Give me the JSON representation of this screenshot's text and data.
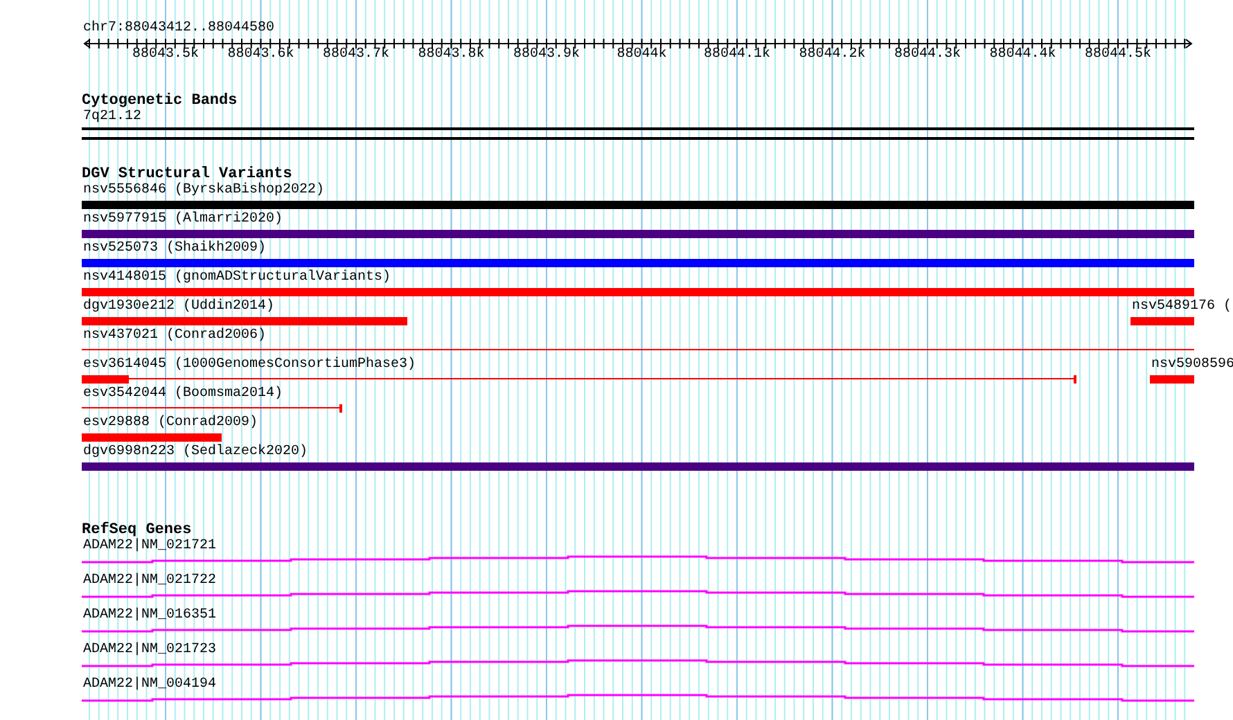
{
  "location": "chr7:88043412..88044580",
  "ruler": {
    "ticks": [
      "88043.5k",
      "88043.6k",
      "88043.7k",
      "88043.8k",
      "88043.9k",
      "88044k",
      "88044.1k",
      "88044.2k",
      "88044.3k",
      "88044.4k",
      "88044.5k"
    ]
  },
  "tracks": [
    {
      "kind": "bands",
      "title": "Cytogenetic Bands",
      "bands": [
        {
          "name": "7q21.12"
        }
      ]
    },
    {
      "kind": "variants",
      "title": "DGV Structural Variants",
      "rows": [
        {
          "features": [
            {
              "label": "nsv5556846 (ByrskaBishop2022)",
              "color": "#000000",
              "glyphs": [
                {
                  "kind": "thick"
                }
              ]
            }
          ]
        },
        {
          "features": [
            {
              "label": "nsv5977915 (Almarri2020)",
              "color": "#4b0082",
              "glyphs": [
                {
                  "kind": "thick"
                }
              ]
            }
          ]
        },
        {
          "features": [
            {
              "label": "nsv525073 (Shaikh2009)",
              "color": "#0000ff",
              "glyphs": [
                {
                  "kind": "thick"
                }
              ]
            }
          ]
        },
        {
          "features": [
            {
              "label": "nsv4148015 (gnomADStructuralVariants)",
              "color": "#ff0000",
              "glyphs": [
                {
                  "kind": "thick"
                }
              ]
            }
          ]
        },
        {
          "features": [
            {
              "label": "dgv1930e212 (Uddin2014)",
              "color": "#ff0000",
              "glyphs": [
                {
                  "kind": "thick"
                }
              ]
            },
            {
              "label": "nsv5489176 (",
              "color": "#ff0000",
              "glyphs": [
                {
                  "kind": "thick"
                }
              ]
            }
          ]
        },
        {
          "features": [
            {
              "label": "nsv437021 (Conrad2006)",
              "color": "#ff0000",
              "glyphs": [
                {
                  "kind": "thin"
                }
              ]
            }
          ]
        },
        {
          "features": [
            {
              "label": "esv3614045 (1000GenomesConsortiumPhase3)",
              "color": "#ff0000",
              "glyphs": [
                {
                  "kind": "thick"
                },
                {
                  "kind": "thin_capped"
                }
              ]
            },
            {
              "label": "nsv5908596",
              "color": "#ff0000",
              "glyphs": [
                {
                  "kind": "thick"
                }
              ]
            }
          ]
        },
        {
          "features": [
            {
              "label": "esv3542044 (Boomsma2014)",
              "color": "#ff0000",
              "glyphs": [
                {
                  "kind": "thin_capped"
                }
              ]
            }
          ]
        },
        {
          "features": [
            {
              "label": "esv29888 (Conrad2009)",
              "color": "#ff0000",
              "glyphs": [
                {
                  "kind": "thick"
                }
              ]
            }
          ]
        },
        {
          "features": [
            {
              "label": "dgv6998n223 (Sedlazeck2020)",
              "color": "#4b0082",
              "glyphs": [
                {
                  "kind": "thick"
                }
              ]
            }
          ]
        }
      ]
    },
    {
      "kind": "genes",
      "title": "RefSeq Genes",
      "genes": [
        {
          "label": "ADAM22|NM_021721"
        },
        {
          "label": "ADAM22|NM_021722"
        },
        {
          "label": "ADAM22|NM_016351"
        },
        {
          "label": "ADAM22|NM_021723"
        },
        {
          "label": "ADAM22|NM_004194"
        }
      ]
    }
  ]
}
